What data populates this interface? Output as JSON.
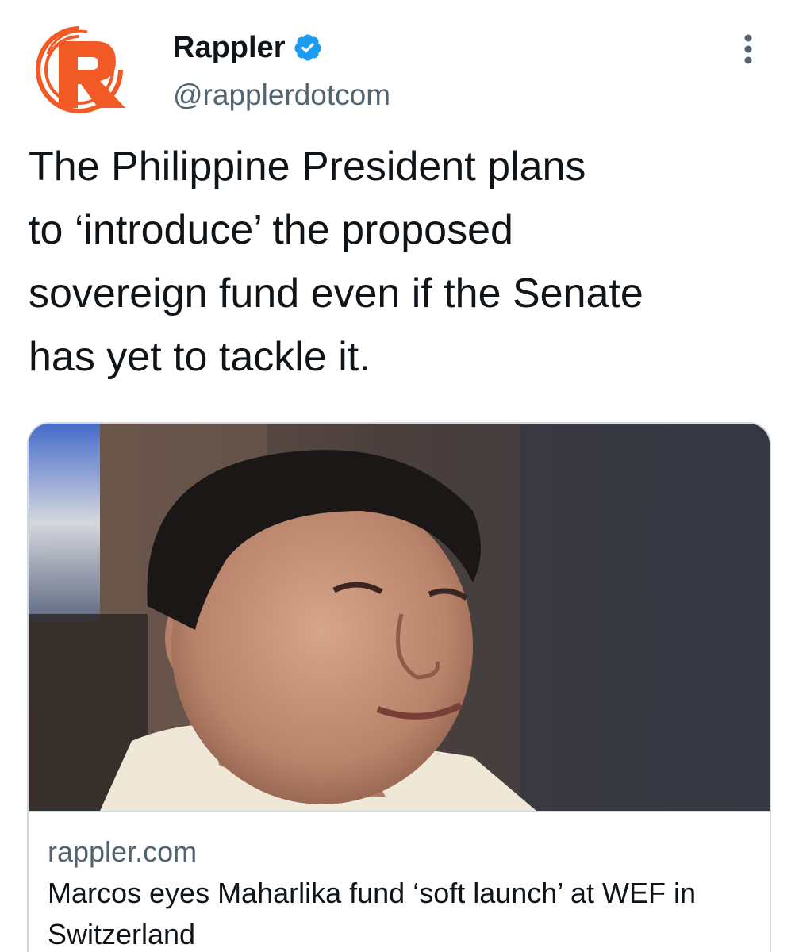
{
  "tweet": {
    "author": {
      "display_name": "Rappler",
      "handle": "@rapplerdotcom",
      "verified": true,
      "avatar_icon": "rappler-logo-icon"
    },
    "text": "The Philippine President plans\nto ‘introduce’ the proposed\nsovereign fund even if the Senate\nhas yet to tackle it.",
    "more_icon": "more-options-icon"
  },
  "card": {
    "domain": "rappler.com",
    "title": "Marcos eyes Maharlika fund ‘soft launch’ at WEF in Switzerland",
    "image_icon": "article-photo"
  },
  "colors": {
    "brand_orange": "#f15a24",
    "verified_blue": "#1d9bf0",
    "text_primary": "#0f1419",
    "text_secondary": "#536471",
    "border": "#cfd9de"
  }
}
